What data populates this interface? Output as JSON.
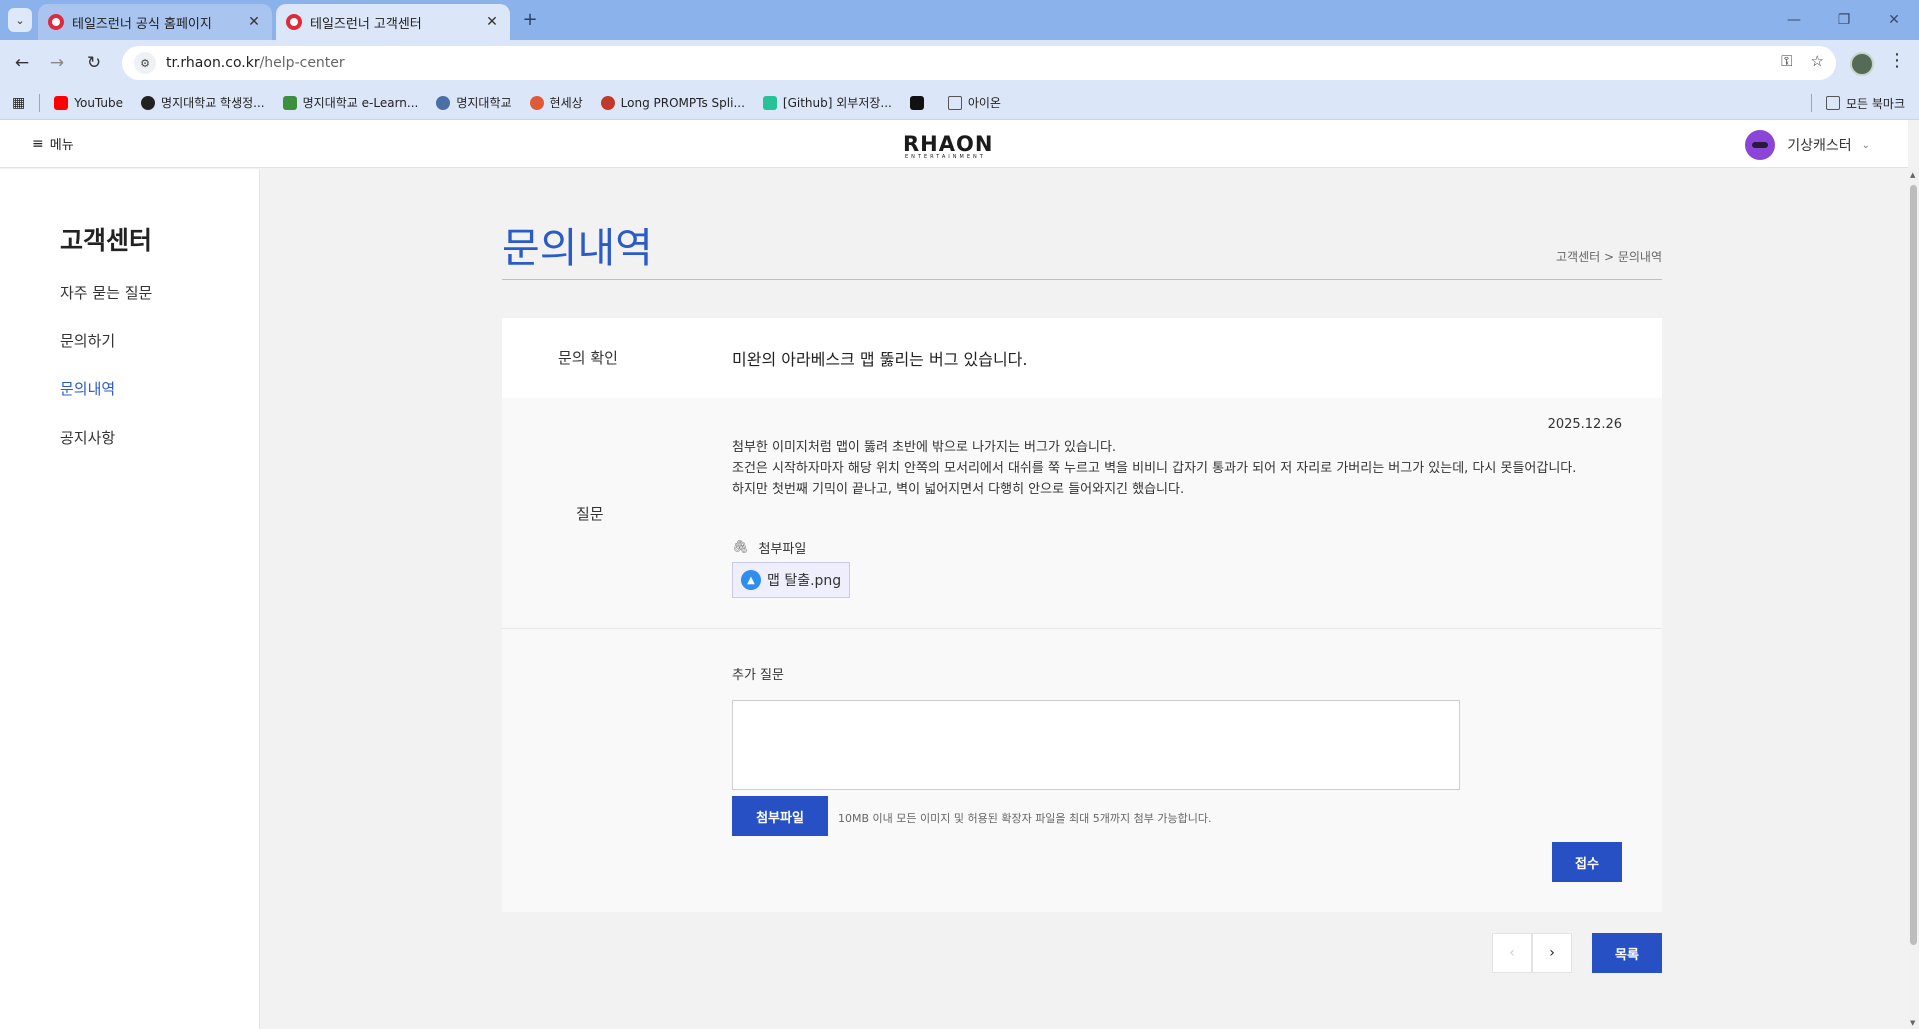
{
  "browser": {
    "tabs": [
      {
        "title": "테일즈런너 공식 홈페이지"
      },
      {
        "title": "테일즈런너 고객센터"
      }
    ],
    "url_host": "tr.rhaon.co.kr",
    "url_path": "/help-center",
    "bookmarks": [
      {
        "label": "YouTube",
        "color": "#ff0000"
      },
      {
        "label": "명지대학교 학생정...",
        "color": "#222222"
      },
      {
        "label": "명지대학교 e-Learn...",
        "color": "#3c8f3c"
      },
      {
        "label": "명지대학교",
        "color": "#4a6fa5"
      },
      {
        "label": "현세상",
        "color": "#e05a3a"
      },
      {
        "label": "Long PROMPTs Spli...",
        "color": "#c0392b"
      },
      {
        "label": "[Github] 외부저장...",
        "color": "#27c19a"
      },
      {
        "label": "",
        "color": "#111111"
      },
      {
        "label": "아이온",
        "color": "#666666"
      }
    ],
    "all_bookmarks": "모든 북마크"
  },
  "header": {
    "menu_label": "메뉴",
    "logo": "RHAON",
    "logo_sub": "ENTERTAINMENT",
    "username": "기상캐스터"
  },
  "sidebar": {
    "title": "고객센터",
    "items": [
      {
        "label": "자주 묻는 질문",
        "active": false
      },
      {
        "label": "문의하기",
        "active": false
      },
      {
        "label": "문의내역",
        "active": true
      },
      {
        "label": "공지사항",
        "active": false
      }
    ]
  },
  "page": {
    "title": "문의내역",
    "breadcrumb": "고객센터 > 문의내역"
  },
  "inquiry": {
    "subject_label": "문의 확인",
    "subject": "미완의 아라베스크 맵 뚫리는 버그 있습니다.",
    "question_label": "질문",
    "date": "2025.12.26",
    "body_lines": [
      "첨부한 이미지처럼 맵이 뚫려 초반에 밖으로 나가지는 버그가 있습니다.",
      "조건은 시작하자마자 해당 위치 안쪽의 모서리에서 대쉬를 쭉 누르고 벽을 비비니 갑자기 통과가 되어 저 자리로 가버리는 버그가 있는데, 다시 못들어갑니다.",
      "하지만 첫번째 기믹이 끝나고, 벽이 넓어지면서 다행히 안으로 들어와지긴 했습니다."
    ],
    "attachment_label": "첨부파일",
    "attachment_file": "맵 탈출.png"
  },
  "followup": {
    "label": "추가 질문",
    "textarea_value": "",
    "attach_button": "첨부파일",
    "attach_hint": "10MB 이내 모든 이미지 및 허용된 확장자 파일을 최대 5개까지 첨부 가능합니다.",
    "submit_button": "접수"
  },
  "pagination": {
    "prev": "‹",
    "next": "›",
    "list_button": "목록"
  },
  "colors": {
    "accent": "#2a5bc8",
    "button": "#2750c4"
  }
}
